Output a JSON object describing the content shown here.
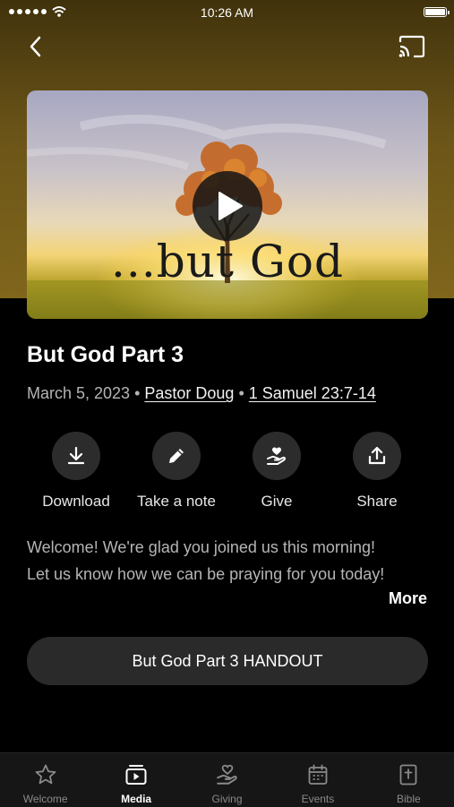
{
  "status_bar": {
    "time": "10:26 AM"
  },
  "video": {
    "overlay_text": "...but God"
  },
  "sermon": {
    "title": "But God Part 3",
    "date": "March 5, 2023",
    "speaker": "Pastor Doug",
    "scripture": "1 Samuel 23:7-14"
  },
  "actions": {
    "download": "Download",
    "note": "Take a note",
    "give": "Give",
    "share": "Share"
  },
  "description": {
    "line1": "Welcome! We're glad you joined us this morning!",
    "line2": "Let us know how we can be praying for you today!",
    "more": "More"
  },
  "handout_button": "But God Part 3 HANDOUT",
  "tabs": {
    "welcome": "Welcome",
    "media": "Media",
    "giving": "Giving",
    "events": "Events",
    "bible": "Bible"
  },
  "colors": {
    "header_gold": "#80661c",
    "background": "#000000"
  }
}
